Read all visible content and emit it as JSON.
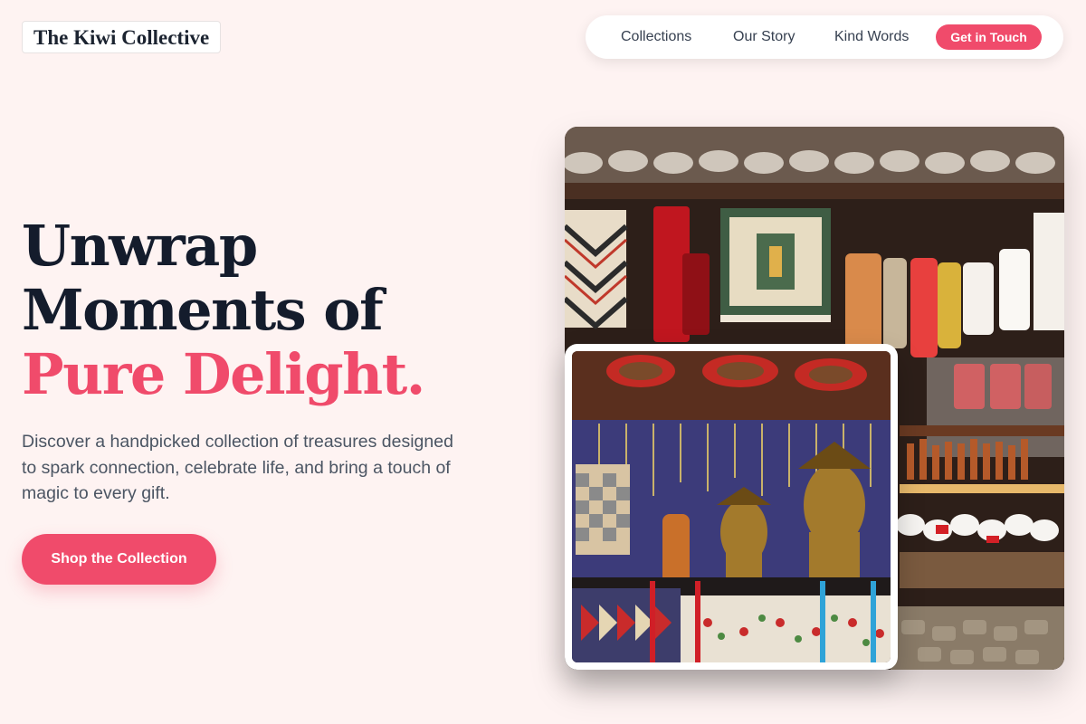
{
  "brand": {
    "name": "The Kiwi Collective"
  },
  "nav": {
    "links": [
      "Collections",
      "Our Story",
      "Kind Words"
    ],
    "cta": "Get in Touch"
  },
  "hero": {
    "line1": "Unwrap",
    "line2": "Moments of",
    "line3": "Pure Delight.",
    "subtitle": "Discover a handpicked collection of treasures designed to spark connection, celebrate life, and bring a touch of magic to every gift.",
    "button": "Shop the Collection"
  },
  "images": {
    "main": "market-stall-photo",
    "inset": "souvenir-stall-photo"
  },
  "colors": {
    "accent": "#f04b6b",
    "background": "#fef3f2",
    "heading": "#141c2c"
  }
}
